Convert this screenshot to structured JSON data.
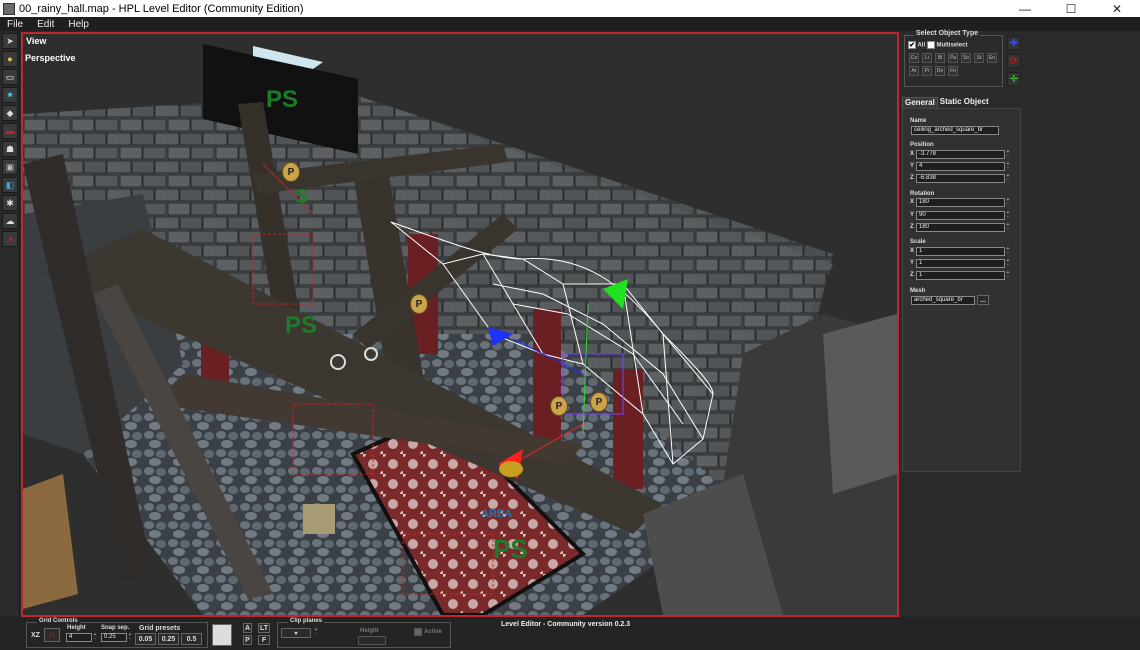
{
  "window": {
    "title": "00_rainy_hall.map - HPL Level Editor (Community Edition)",
    "minimize": "—",
    "maximize": "☐",
    "close": "✕"
  },
  "menu": [
    "File",
    "Edit",
    "Help"
  ],
  "toolbar": {
    "tools": [
      {
        "icon": "select-arrow-icon",
        "glyph": "➤",
        "color": "#dddddd"
      },
      {
        "icon": "light-bulb-icon",
        "glyph": "●",
        "color": "#e8c24a"
      },
      {
        "icon": "billboard-icon",
        "glyph": "▭",
        "color": "#ffffff"
      },
      {
        "icon": "particle-system-icon",
        "glyph": "✷",
        "color": "#4ac8e8"
      },
      {
        "icon": "sound-icon",
        "glyph": "◆",
        "color": "#dddddd"
      },
      {
        "icon": "static-object-icon",
        "glyph": "▬",
        "color": "#d02020"
      },
      {
        "icon": "entity-icon",
        "glyph": "☗",
        "color": "#dddddd"
      },
      {
        "icon": "area-icon",
        "glyph": "▣",
        "color": "#bbbbbb"
      },
      {
        "icon": "primitive-icon",
        "glyph": "◧",
        "color": "#3aa0d8"
      },
      {
        "icon": "decal-icon",
        "glyph": "✱",
        "color": "#dddddd"
      },
      {
        "icon": "fog-area-icon",
        "glyph": "☁",
        "color": "#dddddd"
      },
      {
        "icon": "combine-icon",
        "glyph": "◑",
        "color": "#d02060"
      }
    ]
  },
  "viewport": {
    "view_label": "View",
    "mode_label": "Perspective",
    "ps_label": "PS",
    "s_label": "S",
    "p_label": "P",
    "area_label": "AREA"
  },
  "select_type": {
    "title": "Select Object Type",
    "all_label": "All",
    "all_checked": "✔",
    "multiselect_label": "Multiselect",
    "types": [
      "Co",
      "Li",
      "Bi",
      "Pa",
      "So",
      "St",
      "En",
      "Ar",
      "Pr",
      "De",
      "Fo"
    ]
  },
  "side_buttons": [
    {
      "icon": "translate-icon",
      "glyph": "✚",
      "color": "#3050ff"
    },
    {
      "icon": "rotate-icon",
      "glyph": "⟳",
      "color": "#d02020"
    },
    {
      "icon": "scale-icon",
      "glyph": "✛",
      "color": "#30e030"
    }
  ],
  "tabs": [
    "General",
    "Static Object"
  ],
  "properties": {
    "name_label": "Name",
    "name_value": "ceiling_arched_square_br",
    "position_label": "Position",
    "position": {
      "x": "-3.778",
      "y": "4",
      "z": "-6.838"
    },
    "rotation_label": "Rotation",
    "rotation": {
      "x": "180",
      "y": "90",
      "z": "180"
    },
    "scale_label": "Scale",
    "scale": {
      "x": "1",
      "y": "1",
      "z": "1"
    },
    "mesh_label": "Mesh",
    "mesh_value": "arched_square_br",
    "browse_label": "...",
    "axes": {
      "x": "X",
      "y": "Y",
      "z": "Z"
    }
  },
  "status": {
    "grid_controls_label": "Grid Controls",
    "plane_label": "XZ",
    "height_label": "Height",
    "height_value": "4",
    "snap_label": "Snap sep.",
    "snap_value": "0.25",
    "presets_label": "Grid presets",
    "presets": [
      "0.05",
      "0.25",
      "0.5"
    ],
    "a_label": "A",
    "p_label": "P",
    "lt_label": "LT",
    "f_label": "F",
    "clip_label": "Clip planes",
    "clip_height_label": "Height",
    "clip_active_label": "Active",
    "version": "Level Editor - Community version 0.2.3"
  }
}
